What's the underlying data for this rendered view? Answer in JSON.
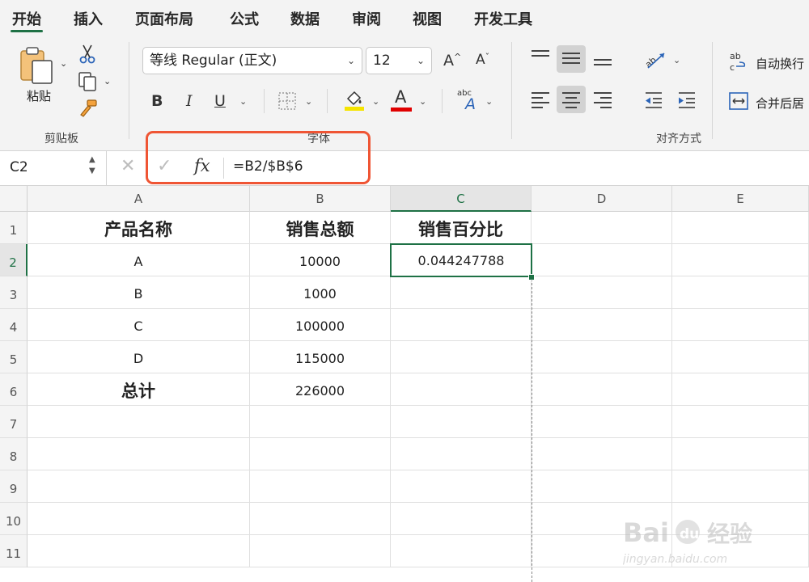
{
  "tabs": [
    "开始",
    "插入",
    "页面布局",
    "公式",
    "数据",
    "审阅",
    "视图",
    "开发工具"
  ],
  "ribbon": {
    "paste_label": "粘贴",
    "clipboard_group": "剪贴板",
    "font_name": "等线 Regular (正文)",
    "font_size": "12",
    "font_group": "字体",
    "align_group": "对齐方式",
    "wrap_text": "自动换行",
    "merge_center": "合并后居",
    "bold": "B",
    "italic": "I",
    "underline": "U",
    "grow_font": "A",
    "shrink_font": "A",
    "font_color_glyph": "A",
    "abc_glyph": "abc"
  },
  "colors": {
    "accent": "#1e7145",
    "highlight_box": "#ef5534",
    "fill_yellow": "#f5e400",
    "font_red": "#e00000"
  },
  "formula_bar": {
    "name_box": "C2",
    "cancel_glyph": "✕",
    "enter_glyph": "✓",
    "fx_label": "fx",
    "formula": "=B2/$B$6"
  },
  "sheet": {
    "columns": [
      "A",
      "B",
      "C",
      "D",
      "E"
    ],
    "row_numbers": [
      "1",
      "2",
      "3",
      "4",
      "5",
      "6",
      "7",
      "8",
      "9",
      "10",
      "11"
    ],
    "selected_cell": "C2",
    "rows": [
      [
        "产品名称",
        "销售总额",
        "销售百分比",
        "",
        ""
      ],
      [
        "A",
        "10000",
        "0.044247788",
        "",
        ""
      ],
      [
        "B",
        "1000",
        "",
        "",
        ""
      ],
      [
        "C",
        "100000",
        "",
        "",
        ""
      ],
      [
        "D",
        "115000",
        "",
        "",
        ""
      ],
      [
        "总计",
        "226000",
        "",
        "",
        ""
      ],
      [
        "",
        "",
        "",
        "",
        ""
      ],
      [
        "",
        "",
        "",
        "",
        ""
      ],
      [
        "",
        "",
        "",
        "",
        ""
      ],
      [
        "",
        "",
        "",
        "",
        ""
      ],
      [
        "",
        "",
        "",
        "",
        ""
      ]
    ]
  },
  "watermark": {
    "brand": "Bai du 经验",
    "url": "jingyan.baidu.com"
  }
}
